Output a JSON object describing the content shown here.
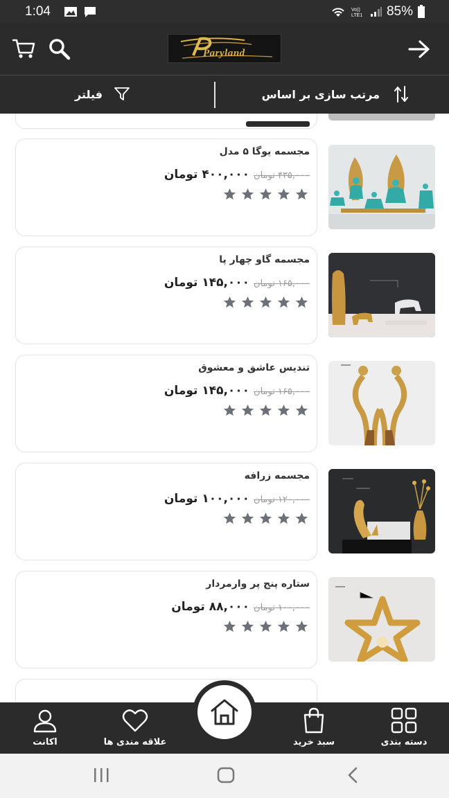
{
  "status_bar": {
    "time": "1:04",
    "battery": "85%",
    "icons": [
      "image-icon",
      "message-icon",
      "wifi-icon",
      "volte-icon",
      "signal-icon",
      "battery-icon"
    ]
  },
  "app_bar": {
    "logo_text": "Paryland",
    "icons": [
      "cart-icon",
      "search-icon",
      "arrow-right-icon"
    ]
  },
  "toolbar": {
    "sort_label": "مرتب سازی بر اساس",
    "filter_label": "فیلتر"
  },
  "products": [
    {
      "name": "مجسمه یوگا ۵ مدل",
      "old_price": "۴۳۵,۰۰۰ تومان",
      "new_price": "۴۰۰,۰۰۰ تومان",
      "rating": 5,
      "image": "yoga-statues"
    },
    {
      "name": "مجسمه گاو چهار پا",
      "old_price": "۱۶۵,۰۰۰ تومان",
      "new_price": "۱۴۵,۰۰۰ تومان",
      "rating": 5,
      "image": "cow-statue"
    },
    {
      "name": "تندیس عاشق و معشوق",
      "old_price": "۱۶۵,۰۰۰ تومان",
      "new_price": "۱۴۵,۰۰۰ تومان",
      "rating": 5,
      "image": "lovers-statue"
    },
    {
      "name": "مجسمه زرافه",
      "old_price": "۱۲۰,۰۰۰ تومان",
      "new_price": "۱۰۰,۰۰۰ تومان",
      "rating": 5,
      "image": "giraffe-statue"
    },
    {
      "name": "ستاره پنج پر وارمردار",
      "old_price": "۱۰۰,۰۰۰ تومان",
      "new_price": "۸۸,۰۰۰ تومان",
      "rating": 5,
      "image": "star-candle-holder"
    }
  ],
  "bottom_nav": {
    "account": "اکانت",
    "favorites": "علاقه مندی ها",
    "home": "home",
    "cart": "سبد خرید",
    "categories": "دسته بندی"
  },
  "colors": {
    "bar_bg": "#2b2b2b",
    "star": "#6b7079",
    "card_border": "#e2e2e2",
    "gold": "#d9b04a"
  }
}
